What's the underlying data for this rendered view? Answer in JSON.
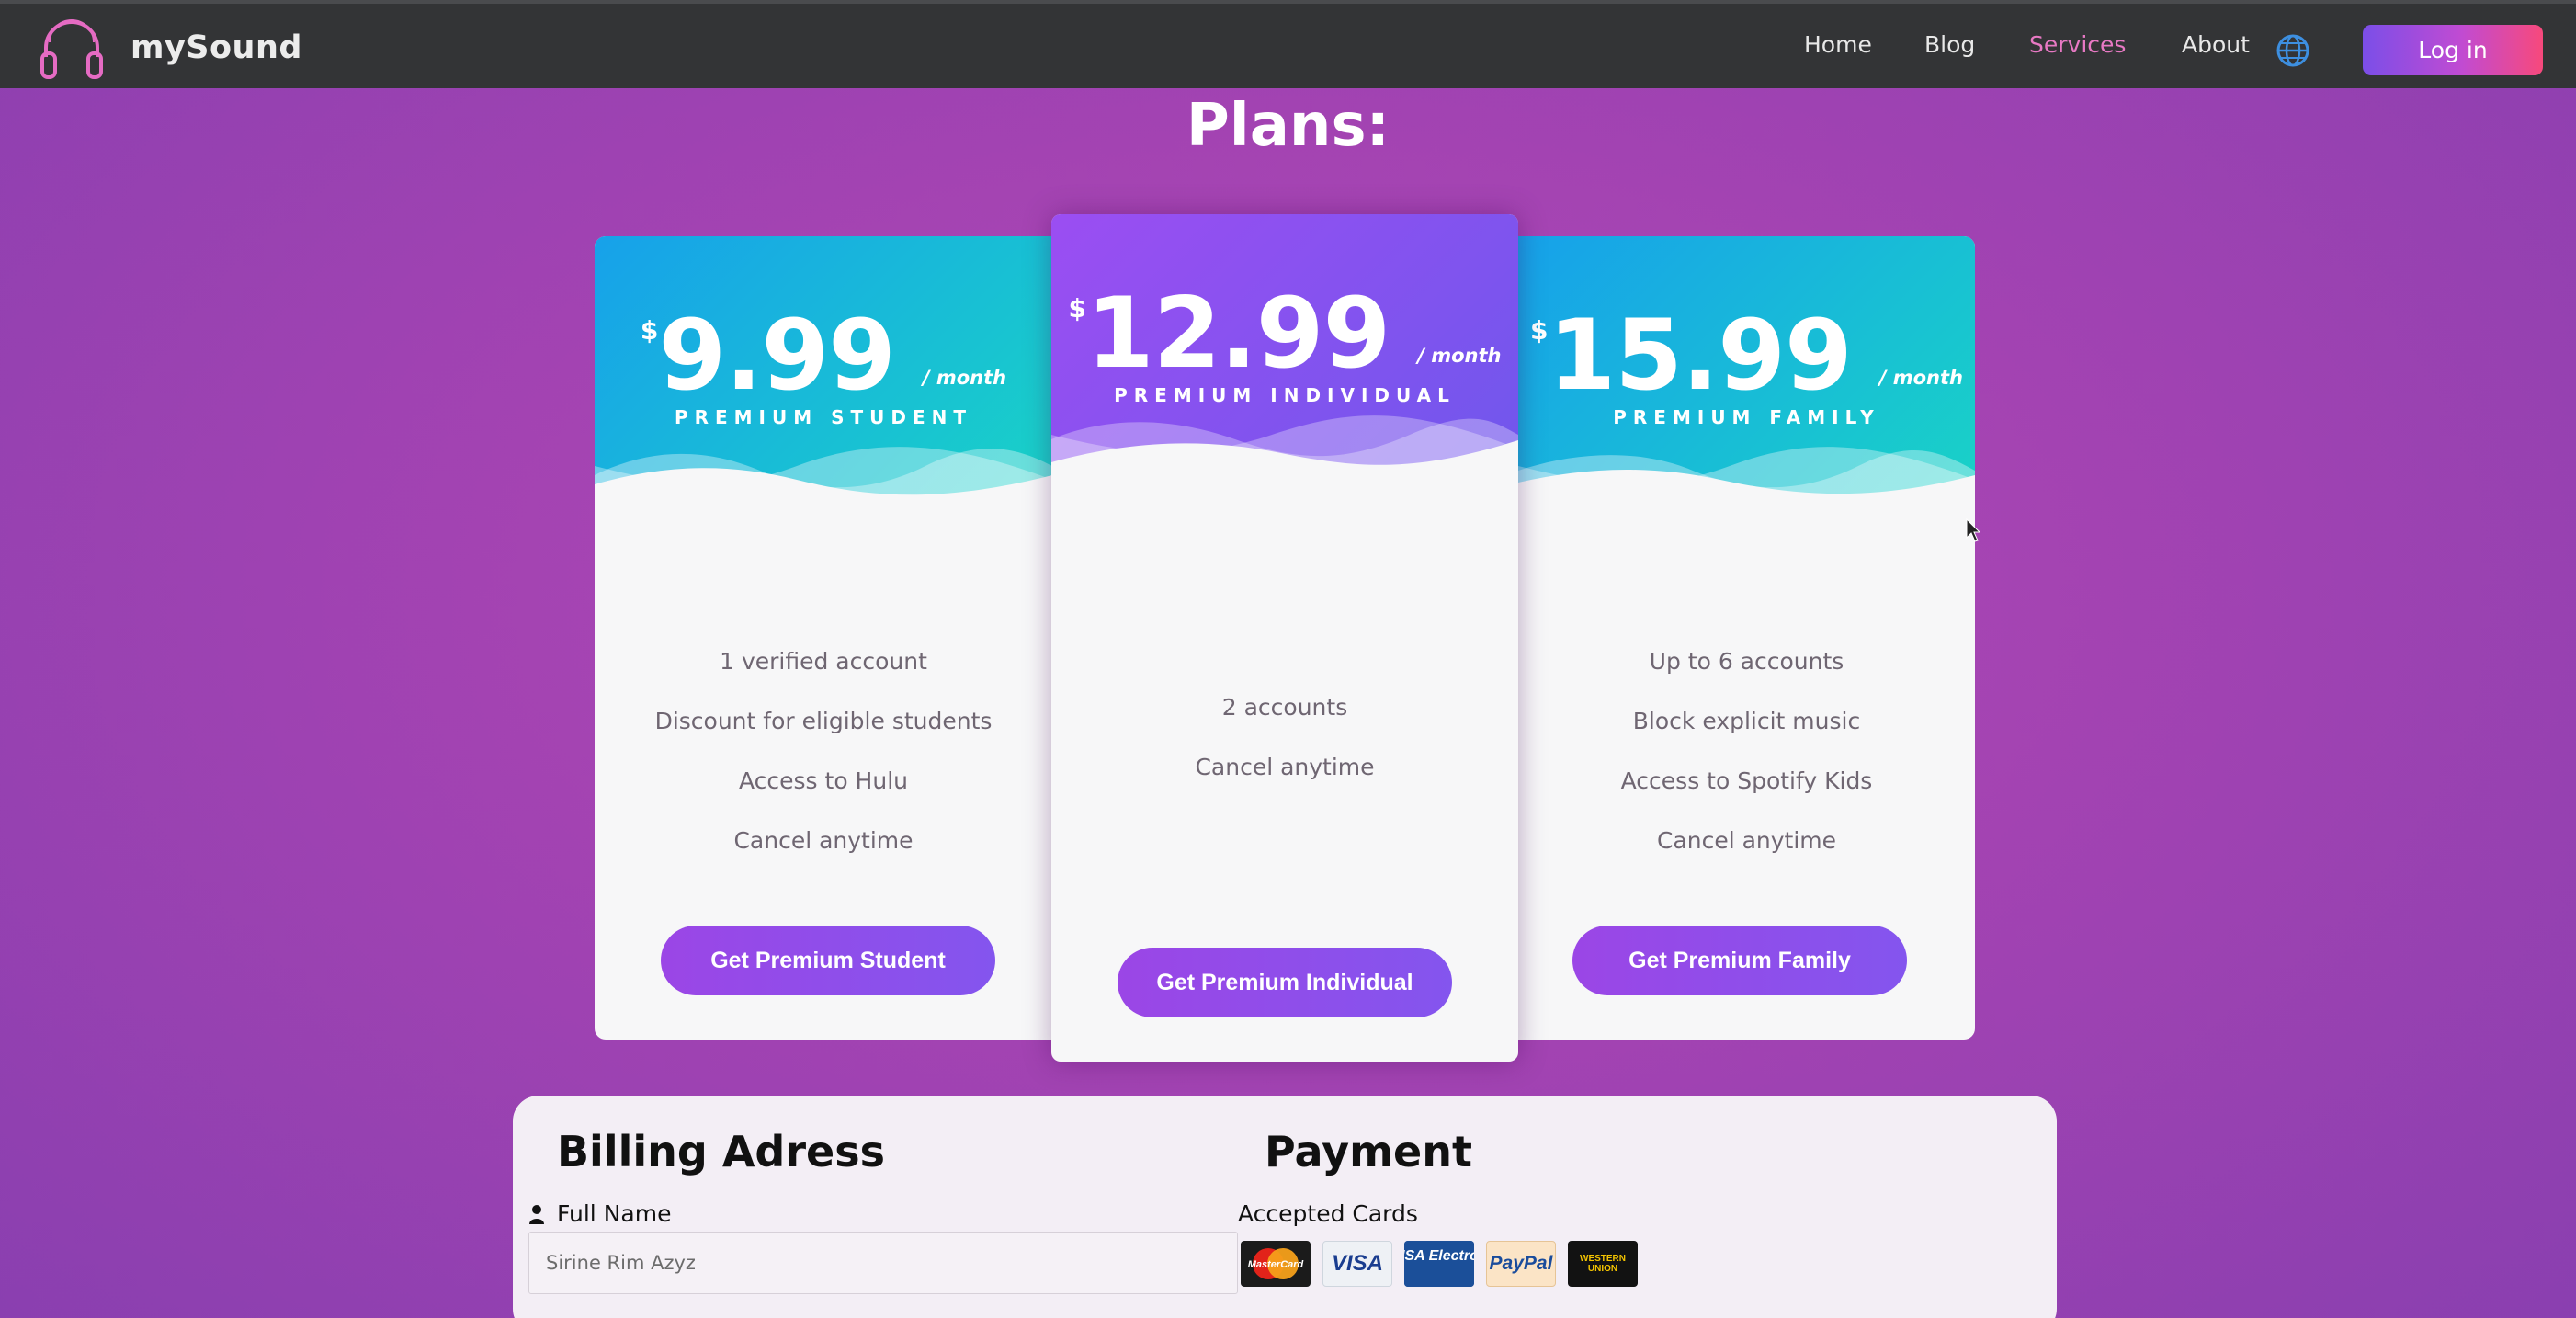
{
  "navbar": {
    "brand": "mySound",
    "links": [
      "Home",
      "Blog",
      "Services",
      "About"
    ],
    "active_link": "Services",
    "login_label": "Log in",
    "icons": {
      "logo": "headphones-icon",
      "language": "globe-icon"
    },
    "colors": {
      "background": "#333436",
      "active": "#e879c4",
      "login_gradient": [
        "#7b4ee8",
        "#f7497c"
      ]
    }
  },
  "page": {
    "title": "Plans:"
  },
  "plans": [
    {
      "currency": "$",
      "price": "9.99",
      "period": "/ month",
      "name": "PREMIUM STUDENT",
      "features": [
        "1 verified account",
        "Discount for eligible students",
        "Access to Hulu",
        "Cancel anytime"
      ],
      "button_label": "Get Premium Student",
      "header_colors": [
        "#17a1ea",
        "#19d3c6"
      ]
    },
    {
      "currency": "$",
      "price": "12.99",
      "period": "/ month",
      "name": "PREMIUM INDIVIDUAL",
      "features": [
        "2 accounts",
        "Cancel anytime"
      ],
      "button_label": "Get Premium Individual",
      "header_colors": [
        "#9b4ef2",
        "#6f57ec"
      ]
    },
    {
      "currency": "$",
      "price": "15.99",
      "period": "/ month",
      "name": "PREMIUM FAMILY",
      "features": [
        "Up to 6 accounts",
        "Block explicit music",
        "Access to Spotify Kids",
        "Cancel anytime"
      ],
      "button_label": "Get Premium Family",
      "header_colors": [
        "#17a1ea",
        "#19d3c6"
      ]
    }
  ],
  "billing": {
    "title": "Billing Adress",
    "full_name_label": "Full Name",
    "full_name_placeholder": "Sirine Rim Azyz"
  },
  "payment": {
    "title": "Payment",
    "accepted_label": "Accepted Cards",
    "cards": [
      "MasterCard",
      "VISA",
      "VISA Electron",
      "PayPal",
      "WESTERN UNION"
    ]
  }
}
